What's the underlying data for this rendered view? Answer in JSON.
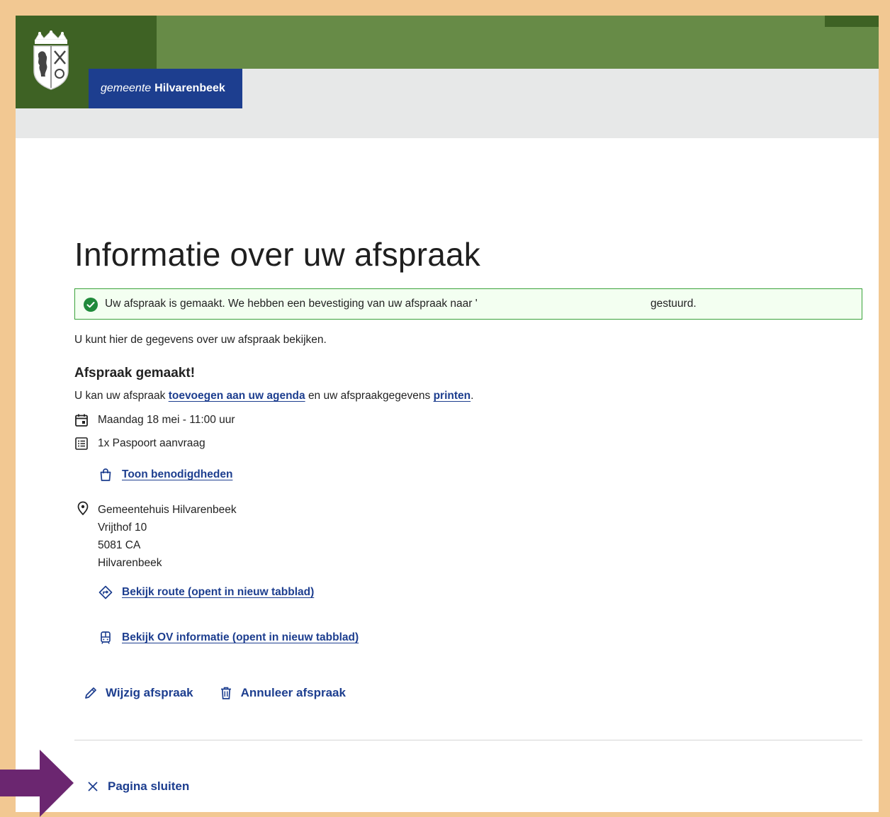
{
  "header": {
    "brand_prefix": "gemeente",
    "brand_name": "Hilvarenbeek",
    "colors": {
      "green": "#678b47",
      "dark_green": "#3e6224",
      "brand_blue": "#1d3e8f",
      "gray": "#e7e8e8"
    }
  },
  "page": {
    "title": "Informatie over uw afspraak",
    "alert": {
      "message": "Uw afspraak is gemaakt. We hebben een bevestiging van uw afspraak naar '",
      "message_end": "gestuurd.",
      "icon": "check-circle-icon",
      "color": "#3aa23a"
    },
    "intro": "U kunt hier de gegevens over uw afspraak bekijken.",
    "subtitle": "Afspraak gemaakt!",
    "print_line": {
      "before": "U kan uw afspraak",
      "agenda_link": "toevoegen aan uw agenda",
      "middle": "en uw afspraakgegevens",
      "print_link": "printen",
      "after": "."
    },
    "appointment": {
      "date": "Maandag 18 mei - 11:00 uur",
      "product": "1x Paspoort aanvraag",
      "requirements_link": "Toon benodigdheden",
      "location": {
        "name": "Gemeentehuis Hilvarenbeek",
        "street": "Vrijthof 10",
        "postcode": "5081 CA",
        "city": "Hilvarenbeek"
      },
      "route_link": "Bekijk route (opent in nieuw tabblad)",
      "ov_link": "Bekijk OV informatie (opent in nieuw tabblad)"
    },
    "actions": {
      "edit": "Wijzig afspraak",
      "cancel": "Annuleer afspraak"
    },
    "close": "Pagina sluiten"
  },
  "annotation": {
    "arrow_color": "#6b2670",
    "frame_color": "#f2c892"
  }
}
